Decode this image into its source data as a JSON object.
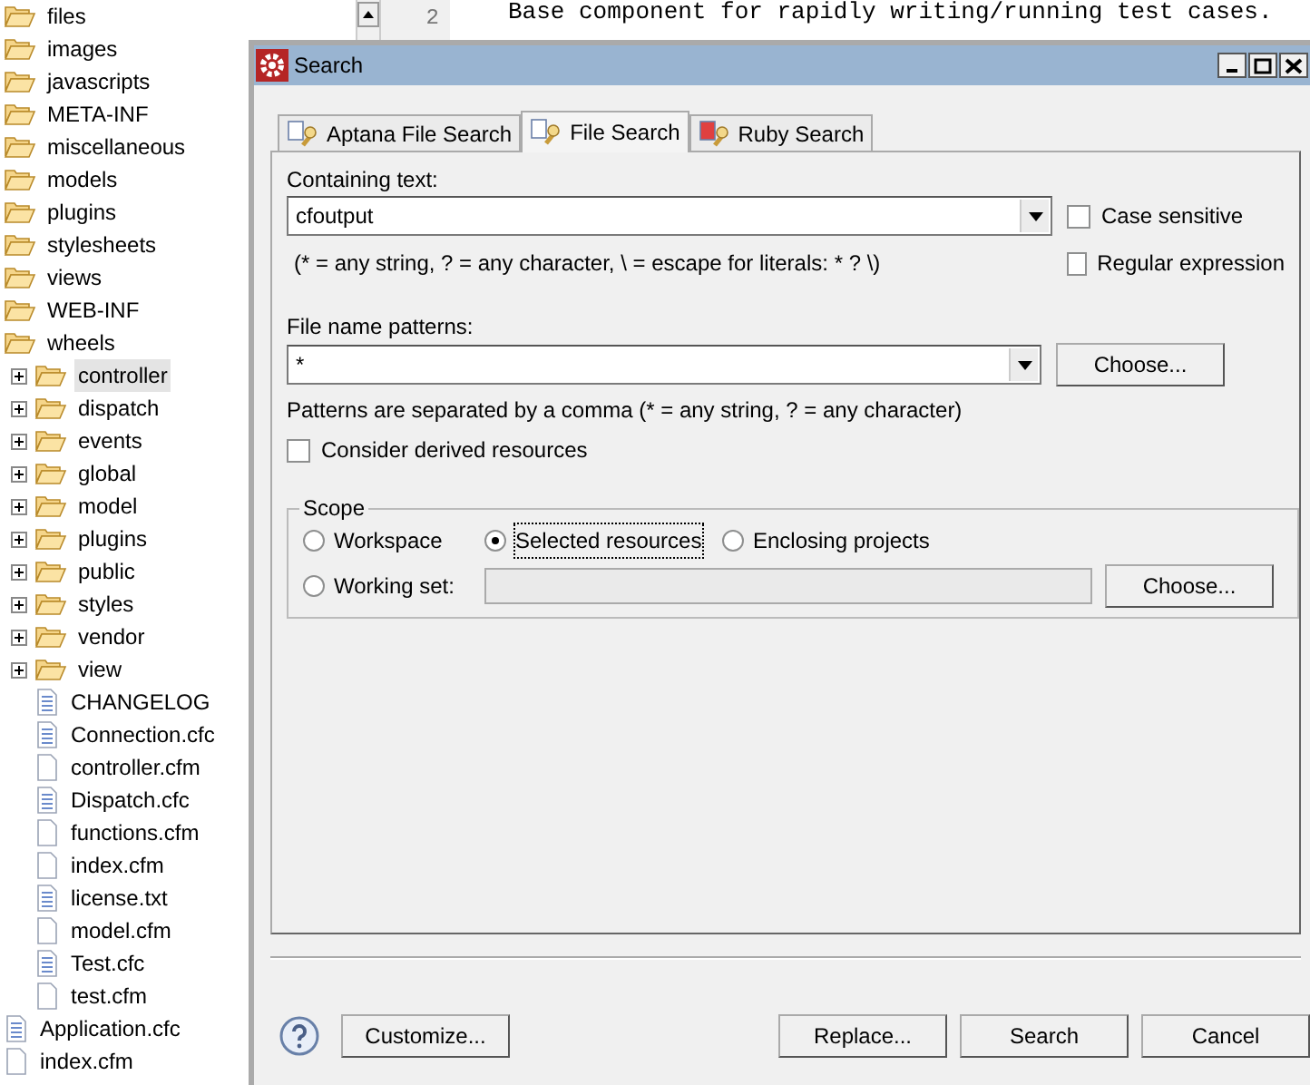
{
  "tree": [
    {
      "label": "files",
      "kind": "folder",
      "selected": false
    },
    {
      "label": "images",
      "kind": "folder",
      "selected": false
    },
    {
      "label": "javascripts",
      "kind": "folder",
      "selected": false
    },
    {
      "label": "META-INF",
      "kind": "folder",
      "selected": false
    },
    {
      "label": "miscellaneous",
      "kind": "folder",
      "selected": false
    },
    {
      "label": "models",
      "kind": "folder",
      "selected": false
    },
    {
      "label": "plugins",
      "kind": "folder",
      "selected": false
    },
    {
      "label": "stylesheets",
      "kind": "folder",
      "selected": false
    },
    {
      "label": "views",
      "kind": "folder",
      "selected": false
    },
    {
      "label": "WEB-INF",
      "kind": "folder",
      "selected": false
    },
    {
      "label": "wheels",
      "kind": "folder",
      "selected": false,
      "children": [
        {
          "label": "controller",
          "kind": "folder",
          "expanded": false,
          "selected": true
        },
        {
          "label": "dispatch",
          "kind": "folder",
          "expanded": false,
          "selected": false
        },
        {
          "label": "events",
          "kind": "folder",
          "expanded": false,
          "selected": false
        },
        {
          "label": "global",
          "kind": "folder",
          "expanded": false,
          "selected": false
        },
        {
          "label": "model",
          "kind": "folder",
          "expanded": false,
          "selected": false
        },
        {
          "label": "plugins",
          "kind": "folder",
          "expanded": false,
          "selected": false
        },
        {
          "label": "public",
          "kind": "folder",
          "expanded": false,
          "selected": false
        },
        {
          "label": "styles",
          "kind": "folder",
          "expanded": false,
          "selected": false
        },
        {
          "label": "vendor",
          "kind": "folder",
          "expanded": false,
          "selected": false
        },
        {
          "label": "view",
          "kind": "folder",
          "expanded": false,
          "selected": false
        },
        {
          "label": "CHANGELOG",
          "kind": "text-file",
          "selected": false
        },
        {
          "label": "Connection.cfc",
          "kind": "text-file",
          "selected": false
        },
        {
          "label": "controller.cfm",
          "kind": "file",
          "selected": false
        },
        {
          "label": "Dispatch.cfc",
          "kind": "text-file",
          "selected": false
        },
        {
          "label": "functions.cfm",
          "kind": "file",
          "selected": false
        },
        {
          "label": "index.cfm",
          "kind": "file",
          "selected": false
        },
        {
          "label": "license.txt",
          "kind": "text-file",
          "selected": false
        },
        {
          "label": "model.cfm",
          "kind": "file",
          "selected": false
        },
        {
          "label": "Test.cfc",
          "kind": "text-file",
          "selected": false
        },
        {
          "label": "test.cfm",
          "kind": "file",
          "selected": false
        }
      ]
    },
    {
      "label": "Application.cfc",
      "kind": "text-file",
      "selected": false
    },
    {
      "label": "index.cfm",
      "kind": "file",
      "selected": false
    }
  ],
  "editor": {
    "line_number": "2",
    "code": "Base component for rapidly writing/running test cases."
  },
  "dialog": {
    "title": "Search",
    "tabs": [
      {
        "label": "Aptana File Search",
        "selected": false
      },
      {
        "label": "File Search",
        "selected": true
      },
      {
        "label": "Ruby Search",
        "selected": false
      }
    ],
    "containing_text": {
      "label": "Containing text:",
      "value": "cfoutput"
    },
    "case_sensitive": {
      "label": "Case sensitive",
      "checked": false
    },
    "regular_expression": {
      "label": "Regular expression",
      "checked": false
    },
    "text_hint": "(* = any string, ? = any character, \\ = escape for literals: * ? \\)",
    "file_name_patterns": {
      "label": "File name patterns:",
      "value": "*",
      "button": "Choose..."
    },
    "patterns_hint": "Patterns are separated by a comma (* = any string, ? = any character)",
    "consider_derived": {
      "label": "Consider derived resources",
      "checked": false
    },
    "scope": {
      "title": "Scope",
      "options": [
        {
          "label": "Workspace",
          "selected": false
        },
        {
          "label": "Selected resources",
          "selected": true
        },
        {
          "label": "Enclosing projects",
          "selected": false
        }
      ],
      "working_set": {
        "label": "Working set:",
        "selected": false,
        "button": "Choose..."
      }
    },
    "buttons": {
      "customize": "Customize...",
      "replace": "Replace...",
      "search": "Search",
      "cancel": "Cancel"
    }
  }
}
